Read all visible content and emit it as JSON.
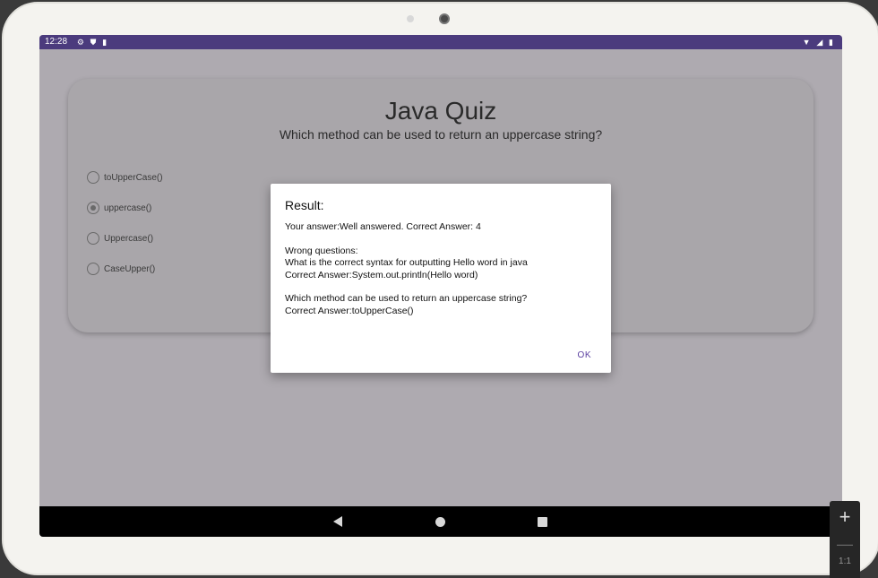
{
  "status_bar": {
    "time": "12:28",
    "left_icons": [
      "gear-icon",
      "shield-icon",
      "sd-card-icon"
    ],
    "right_icons": [
      "wifi-icon",
      "signal-icon",
      "battery-icon"
    ]
  },
  "quiz": {
    "title": "Java Quiz",
    "question": "Which method can be used to return an uppercase string?",
    "options": [
      {
        "label": "toUpperCase()",
        "checked": false
      },
      {
        "label": "uppercase()",
        "checked": true
      },
      {
        "label": "Uppercase()",
        "checked": false
      },
      {
        "label": "CaseUpper()",
        "checked": false
      }
    ]
  },
  "dialog": {
    "title": "Result:",
    "lines": [
      "Your answer:Well answered. Correct Answer: 4",
      "",
      "Wrong questions:",
      "What is the correct syntax for outputting Hello word in java",
      "Correct Answer:System.out.println(Hello word)",
      "",
      "Which method can be used to return an uppercase string?",
      "Correct Answer:toUpperCase()"
    ],
    "ok_label": "OK"
  },
  "nav": {
    "back_icon": "back-icon",
    "home_icon": "home-icon",
    "recents_icon": "recents-icon"
  },
  "zoom": {
    "in_label": "+",
    "out_label": "—",
    "reset_label": "1:1"
  },
  "colors": {
    "status_bar": "#4b3b7d",
    "accent": "#5a3fa0",
    "scrim_background": "#aeaab0"
  }
}
